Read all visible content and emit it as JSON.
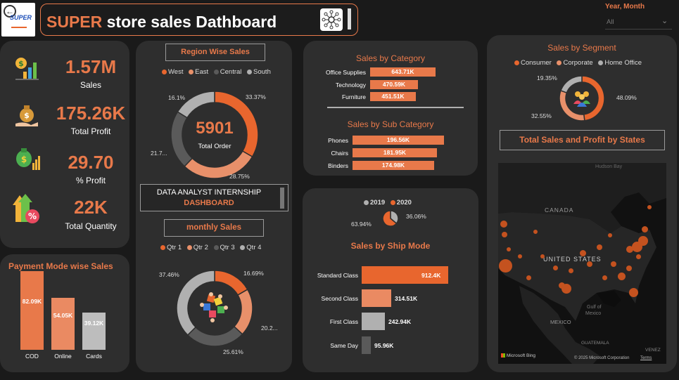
{
  "header": {
    "logo_text": "SUPER",
    "title_brand": "SUPER",
    "title_rest": "store sales Dathboard",
    "filter_label": "Year, Month",
    "filter_value": "All"
  },
  "kpis": [
    {
      "value": "1.57M",
      "label": "Sales",
      "icon": "chart-bar-dollar-icon"
    },
    {
      "value": "175.26K",
      "label": "Total Profit",
      "icon": "money-bag-hand-icon"
    },
    {
      "value": "29.70",
      "label": "% Profit",
      "icon": "money-bag-growth-icon"
    },
    {
      "value": "22K",
      "label": "Total Quantity",
      "icon": "percent-growth-icon"
    }
  ],
  "payment": {
    "title": "Payment Mode wise Sales",
    "bars": [
      {
        "label": "COD",
        "value_label": "82.09K",
        "value": 82.09,
        "color": "#e8794a"
      },
      {
        "label": "Online",
        "value_label": "54.05K",
        "value": 54.05,
        "color": "#ea8a62"
      },
      {
        "label": "Cards",
        "value_label": "39.12K",
        "value": 39.12,
        "color": "#bdbdbd"
      }
    ]
  },
  "region": {
    "title": "Region Wise Sales",
    "legend": [
      {
        "name": "West",
        "color": "#e8662e"
      },
      {
        "name": "East",
        "color": "#e8906a"
      },
      {
        "name": "Central",
        "color": "#5a5a5a"
      },
      {
        "name": "South",
        "color": "#b0b0b0"
      }
    ],
    "center_value": "5901",
    "center_label": "Total Order",
    "labels": [
      "33.37%",
      "28.75%",
      "21.7...",
      "16.1%"
    ],
    "values": [
      33.37,
      28.75,
      21.78,
      16.1
    ]
  },
  "internship": {
    "line1": "DATA ANALYST INTERNSHIP",
    "line2": "DASHBOARD"
  },
  "monthly": {
    "title": "monthly Sales",
    "legend": [
      {
        "name": "Qtr 1",
        "color": "#e8662e"
      },
      {
        "name": "Qtr 2",
        "color": "#e8906a"
      },
      {
        "name": "Qtr 3",
        "color": "#5a5a5a"
      },
      {
        "name": "Qtr 4",
        "color": "#b0b0b0"
      }
    ],
    "labels": [
      "16.69%",
      "20.2...",
      "25.61%",
      "37.46%"
    ],
    "values": [
      16.69,
      20.24,
      25.61,
      37.46
    ]
  },
  "category": {
    "title": "Sales by Category",
    "items": [
      {
        "label": "Office Supplies",
        "value_label": "643.71K",
        "value": 643.71
      },
      {
        "label": "Technology",
        "value_label": "470.59K",
        "value": 470.59
      },
      {
        "label": "Furniture",
        "value_label": "451.51K",
        "value": 451.51
      }
    ]
  },
  "subcategory": {
    "title": "Sales by Sub Category",
    "items": [
      {
        "label": "Phones",
        "value_label": "196.56K",
        "value": 196.56
      },
      {
        "label": "Chairs",
        "value_label": "181.95K",
        "value": 181.95
      },
      {
        "label": "Binders",
        "value_label": "174.98K",
        "value": 174.98
      }
    ]
  },
  "year_pie": {
    "legend": [
      {
        "name": "2019",
        "color": "#b0b0b0"
      },
      {
        "name": "2020",
        "color": "#e8662e"
      }
    ],
    "labels": [
      "63.94%",
      "36.06%"
    ],
    "values": [
      63.94,
      36.06
    ]
  },
  "shipmode": {
    "title": "Sales by Ship Mode",
    "items": [
      {
        "label": "Standard Class",
        "value_label": "912.4K",
        "value": 912.4,
        "color": "#e8662e"
      },
      {
        "label": "Second Class",
        "value_label": "314.51K",
        "value": 314.51,
        "color": "#ea8a62"
      },
      {
        "label": "First Class",
        "value_label": "242.94K",
        "value": 242.94,
        "color": "#b0b0b0"
      },
      {
        "label": "Same Day",
        "value_label": "95.96K",
        "value": 95.96,
        "color": "#5a5a5a"
      }
    ]
  },
  "segment": {
    "title": "Sales by Segment",
    "legend": [
      {
        "name": "Consumer",
        "color": "#e8662e"
      },
      {
        "name": "Corporate",
        "color": "#e8906a"
      },
      {
        "name": "Home Office",
        "color": "#b0b0b0"
      }
    ],
    "labels": [
      "48.09%",
      "32.55%",
      "19.35%"
    ],
    "values": [
      48.09,
      32.55,
      19.36
    ]
  },
  "map": {
    "title": "Total Sales and Profit by States",
    "labels": {
      "canada": "CANADA",
      "hudson": "Hudson Bay",
      "us": "UNITED STATES",
      "gulf1": "Gulf of",
      "gulf2": "Mexico",
      "mexico": "MEXICO",
      "guatemala": "GUATEMALA",
      "venezuela": "VENEZ",
      "bing": "Microsoft Bing",
      "copyright": "© 2025 Microsoft Corporation",
      "terms": "Terms"
    }
  }
}
